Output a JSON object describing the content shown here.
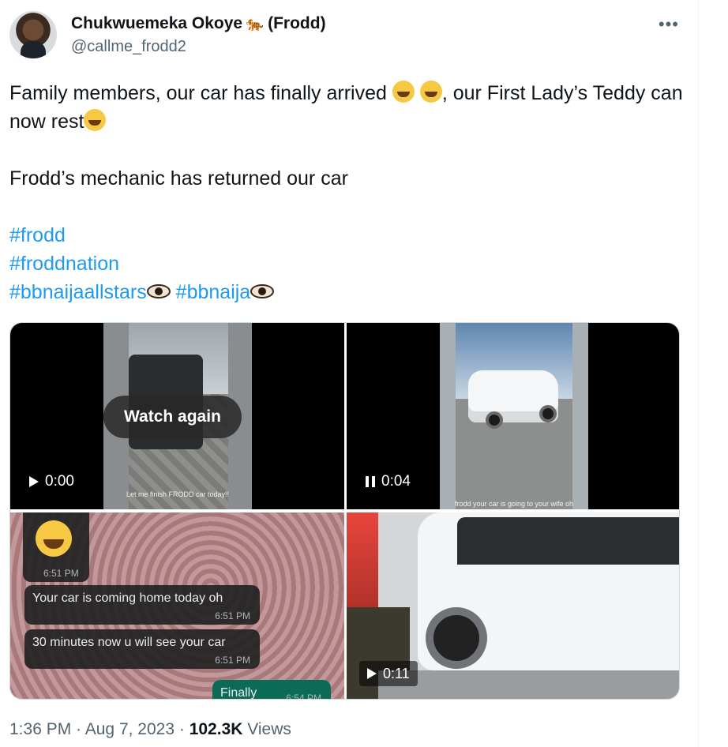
{
  "author": {
    "display_name": "Chukwuemeka Okoye",
    "display_suffix": "(Frodd)",
    "emoji_icon": "tiger-icon",
    "handle": "@callme_frodd2"
  },
  "tweet": {
    "line1_a": "Family members, our car has finally arrived ",
    "line1_b": ", our First Lady’s Teddy can now rest",
    "line2": "Frodd’s mechanic has returned our car",
    "hashtags": [
      "#frodd",
      "#froddnation",
      "#bbnaijaallstars",
      "#bbnaija"
    ]
  },
  "media": {
    "video1": {
      "overlay_label": "Watch again",
      "time": "0:00",
      "state": "play",
      "caption": "Let me finish FRODD car today!!"
    },
    "video2": {
      "time": "0:04",
      "state": "pause",
      "caption": "frodd your car is going to your wife oh"
    },
    "chat": {
      "messages": [
        {
          "text": "",
          "time": "6:51 PM"
        },
        {
          "text": "Your car is coming home today oh",
          "time": "6:51 PM"
        },
        {
          "text": "30 minutes now u will see your car",
          "time": "6:51 PM"
        },
        {
          "text": "Finally",
          "time": "6:54 PM"
        }
      ]
    },
    "video4": {
      "time": "0:11"
    }
  },
  "meta": {
    "time": "1:36 PM",
    "separator": "·",
    "date": "Aug 7, 2023",
    "views_count": "102.3K",
    "views_label": "Views"
  },
  "colors": {
    "link": "#1d9bf0",
    "secondary_text": "#536471",
    "primary_text": "#0f1419"
  }
}
